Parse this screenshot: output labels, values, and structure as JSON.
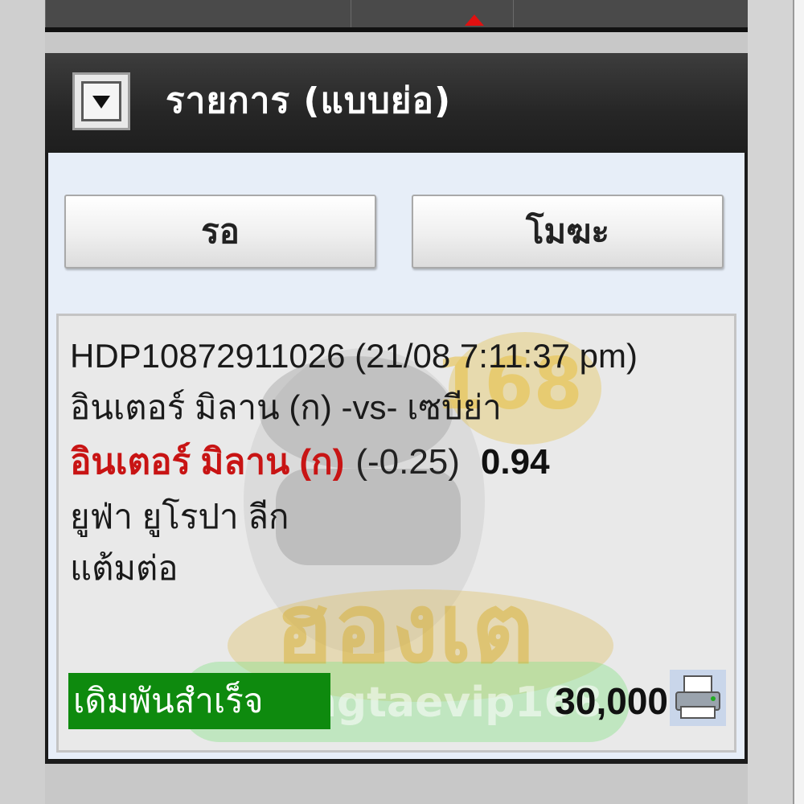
{
  "panel": {
    "title": "รายการ (แบบย่อ)"
  },
  "tabs": [
    {
      "label": "รอ"
    },
    {
      "label": "โมฆะ"
    }
  ],
  "ticket": {
    "ref": "HDP10872911026 (21/08 7:11:37 pm)",
    "match": "อินเตอร์ มิลาน (ก) -vs- เซบีย่า",
    "pick_team": "อินเตอร์ มิลาน (ก)",
    "handicap": "(-0.25)",
    "odds": "0.94",
    "league": "ยูฟ่า ยูโรปา ลีก",
    "bet_type": "แต้มต่อ",
    "status": "เดิมพันสำเร็จ",
    "stake": "30,000"
  },
  "watermark": {
    "number": "168",
    "brand_thai": "ฮองเต",
    "handle": "@hongtaevip168"
  },
  "colors": {
    "header_bg": "#262626",
    "body_bg": "#e7eef8",
    "pick_team": "#c81414",
    "status_bg": "#0e8a0e"
  },
  "icons": [
    "collapse-toggle-icon",
    "printer-icon"
  ]
}
